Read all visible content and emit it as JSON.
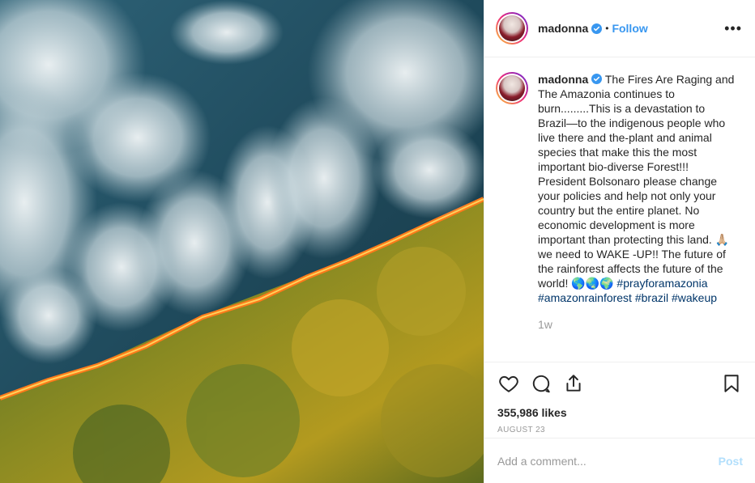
{
  "post": {
    "image_alt_icon": "photo-amazon-fire",
    "header": {
      "username": "madonna",
      "separator": "•",
      "follow_label": "Follow",
      "more_icon": "more-horizontal-icon"
    },
    "caption": {
      "username": "madonna",
      "text": "The Fires Are Raging and The Amazonia continues to burn.........This is a devastation to Brazil—to the indigenous people who live there and the-plant and animal species that make this the most important bio-diverse Forest!!! President Bolsonaro please change your policies and help not only your country but the entire planet. No economic development is more important than protecting this land. 🙏🏼 we need to WAKE -UP!! The future of the rainforest affects the future of the world! 🌎🌏🌍",
      "hashtags": [
        "#prayforamazonia",
        "#amazonrainforest",
        "#brazil",
        "#wakeup"
      ],
      "time": "1w"
    },
    "actions": {
      "like_icon": "heart-icon",
      "comment_icon": "comment-icon",
      "share_icon": "share-icon",
      "save_icon": "bookmark-icon"
    },
    "likes": "355,986 likes",
    "date": "AUGUST 23",
    "comment_box": {
      "placeholder": "Add a comment...",
      "post_label": "Post"
    },
    "colors": {
      "link_blue": "#3897f0",
      "hashtag_blue": "#003569",
      "muted": "#999999",
      "post_disabled": "#b2dffc"
    }
  }
}
